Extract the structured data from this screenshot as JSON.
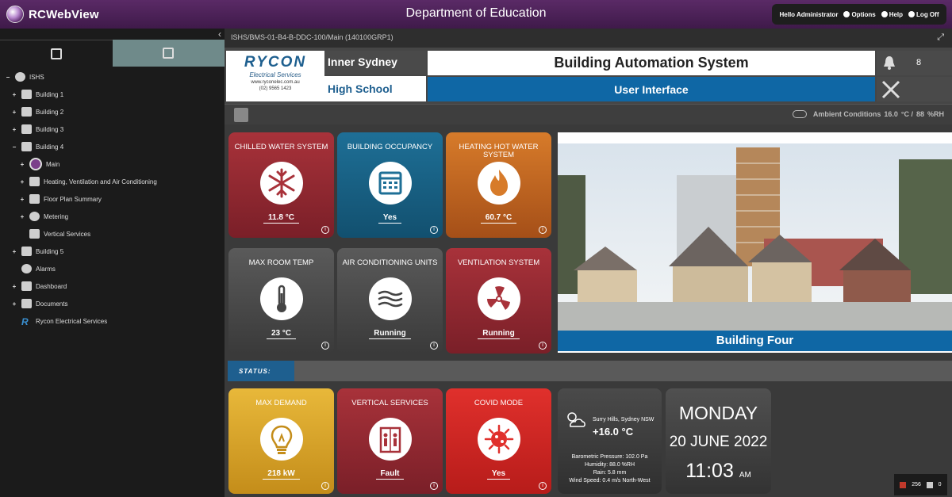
{
  "app": {
    "name": "RCWebView",
    "title": "Department of Education",
    "user_greeting": "Hello Administrator",
    "options_label": "Options",
    "help_label": "Help",
    "logoff_label": "Log Off"
  },
  "tree": {
    "root": "ISHS",
    "items": [
      {
        "label": "Building 1"
      },
      {
        "label": "Building 2"
      },
      {
        "label": "Building 3"
      },
      {
        "label": "Building 4"
      },
      {
        "label": "Main"
      },
      {
        "label": "Heating, Ventilation and Air Conditioning"
      },
      {
        "label": "Floor Plan Summary"
      },
      {
        "label": "Metering"
      },
      {
        "label": "Vertical Services"
      },
      {
        "label": "Building 5"
      },
      {
        "label": "Alarms"
      },
      {
        "label": "Dashboard"
      },
      {
        "label": "Documents"
      },
      {
        "label": "Rycon Electrical Services"
      }
    ]
  },
  "path": "ISHS/BMS-01-B4-B-DDC-100/Main (140100GRP1)",
  "header": {
    "logo_name": "RYCON",
    "logo_sub": "Electrical Services",
    "logo_web": "www.ryconelec.com.au",
    "logo_phone": "(02) 9565 1423",
    "site_line1": "Inner Sydney",
    "site_line2": "High School",
    "title": "Building Automation System",
    "subtitle": "User Interface",
    "alarm_count": "8"
  },
  "ambient": {
    "label": "Ambient Conditions",
    "temp": "16.0",
    "temp_unit": "°C /",
    "humidity": "88",
    "humidity_unit": "%RH"
  },
  "tiles": [
    {
      "title": "CHILLED WATER SYSTEM",
      "value": "11.8 °C",
      "icon": "snowflake-icon"
    },
    {
      "title": "BUILDING OCCUPANCY",
      "value": "Yes",
      "icon": "calendar-icon"
    },
    {
      "title": "HEATING HOT WATER SYSTEM",
      "value": "60.7 °C",
      "icon": "flame-icon"
    },
    {
      "title": "MAX ROOM TEMP",
      "value": "23 °C",
      "icon": "thermometer-icon"
    },
    {
      "title": "AIR CONDITIONING UNITS",
      "value": "Running",
      "icon": "airflow-icon"
    },
    {
      "title": "VENTILATION SYSTEM",
      "value": "Running",
      "icon": "fan-icon"
    },
    {
      "title": "MAX DEMAND",
      "value": "218 kW",
      "icon": "lightbulb-icon"
    },
    {
      "title": "VERTICAL SERVICES",
      "value": "Fault",
      "icon": "elevator-icon"
    },
    {
      "title": "COVID MODE",
      "value": "Yes",
      "icon": "virus-icon"
    }
  ],
  "building_label": "Building Four",
  "status_label": "STATUS:",
  "weather": {
    "location": "Surry Hills, Sydney NSW",
    "temp": "+16.0 °C",
    "pressure": "Barometric Pressure: 102.0 Pa",
    "humidity": "Humidity: 88.0 %RH",
    "rain": "Rain: 5.8 mm",
    "wind": "Wind Speed: 0.4 m/s North-West"
  },
  "datetime": {
    "day": "MONDAY",
    "date": "20 JUNE 2022",
    "time": "11:03",
    "ampm": "AM"
  },
  "counter": {
    "a": "256",
    "b": "0"
  }
}
